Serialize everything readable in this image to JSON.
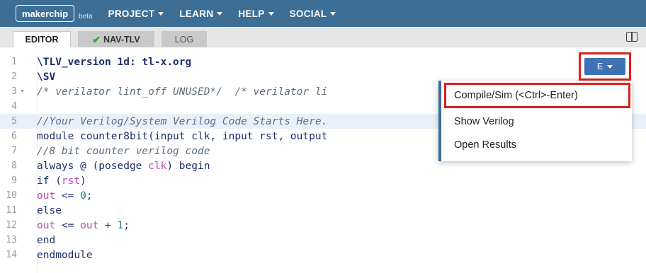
{
  "nav": {
    "logo": "makerchip",
    "beta": "beta",
    "items": [
      "PROJECT",
      "LEARN",
      "HELP",
      "SOCIAL"
    ]
  },
  "tabs": {
    "editor": "EDITOR",
    "nav_tlv": "NAV-TLV",
    "log": "LOG"
  },
  "editor": {
    "line_numbers": [
      "1",
      "2",
      "3",
      "4",
      "5",
      "6",
      "7",
      "8",
      "9",
      "10",
      "11",
      "12",
      "13",
      "14"
    ],
    "l1": "\\TLV_version 1d: tl-x.org",
    "l2": "\\SV",
    "l3a": "/* verilator lint_off UNUSED*/",
    "l3b": "  /* verilator li",
    "l5": "//Your Verilog/System Verilog Code Starts Here.",
    "l6a": "module counter8bit(input clk, input rst, output",
    "l7": "//8 bit counter verilog code",
    "l8a": "always @ (posedge ",
    "l8b": "clk",
    "l8c": ") begin",
    "l9a": "if (",
    "l9b": "rst",
    "l9c": ")",
    "l10a": "out",
    "l10b": " <= ",
    "l10c": "0",
    "l10d": ";",
    "l11": "else",
    "l12a": "out",
    "l12b": " <= ",
    "l12c": "out",
    "l12d": " + ",
    "l12e": "1",
    "l12f": ";",
    "l13": "end",
    "l14": "endmodule"
  },
  "e_button": {
    "label": "E"
  },
  "menu": {
    "items": [
      "Compile/Sim (<Ctrl>-Enter)",
      "Show Verilog",
      "Open Results"
    ]
  },
  "colors": {
    "topbar": "#3c6e96",
    "accent_button": "#3f72b5",
    "highlight_box": "#e01e1e",
    "check": "#28a428"
  }
}
